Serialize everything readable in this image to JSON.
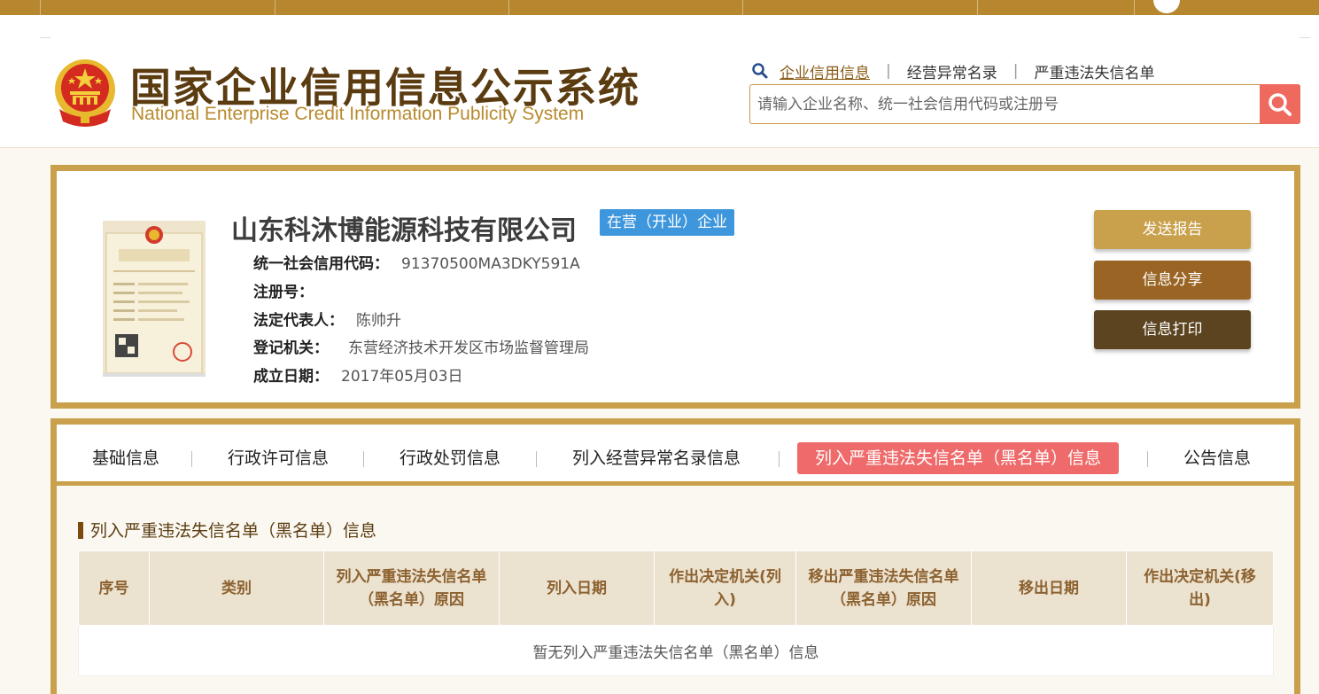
{
  "header": {
    "logo_cn": "国家企业信用信息公示系统",
    "logo_en": "National Enterprise Credit Information Publicity System",
    "quick_links": [
      "企业信用信息",
      "经营异常名录",
      "严重违法失信名单"
    ],
    "search_placeholder": "请输入企业名称、统一社会信用代码或注册号"
  },
  "company": {
    "name": "山东科沐博能源科技有限公司",
    "status": "在营（开业）企业",
    "fields": [
      {
        "label": "统一社会信用代码：",
        "value": "91370500MA3DKY591A"
      },
      {
        "label": "注册号：",
        "value": ""
      },
      {
        "label": "法定代表人：",
        "value": "陈帅升"
      },
      {
        "label": "登记机关：",
        "value": "东营经济技术开发区市场监督管理局"
      },
      {
        "label": "成立日期：",
        "value": "2017年05月03日"
      }
    ],
    "actions": [
      "发送报告",
      "信息分享",
      "信息打印"
    ]
  },
  "tabs": [
    "基础信息",
    "行政许可信息",
    "行政处罚信息",
    "列入经营异常名录信息",
    "列入严重违法失信名单（黑名单）信息",
    "公告信息"
  ],
  "section": {
    "title": "列入严重违法失信名单（黑名单）信息",
    "columns": [
      "序号",
      "类别",
      "列入严重违法失信名单（黑名单）原因",
      "列入日期",
      "作出决定机关(列入)",
      "移出严重违法失信名单（黑名单）原因",
      "移出日期",
      "作出决定机关(移出)"
    ],
    "empty_text": "暂无列入严重违法失信名单（黑名单）信息"
  },
  "colors": {
    "gold": "#c9a04b",
    "btn_send": "#c9a04b",
    "btn_share": "#9a6524",
    "btn_print": "#5c4420",
    "active_tab": "#ef6a6a",
    "status_badge": "#3e96dc"
  }
}
